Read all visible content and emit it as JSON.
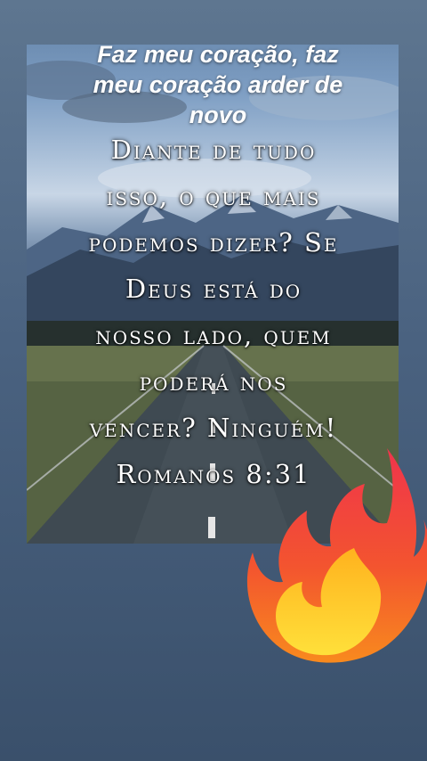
{
  "caption": {
    "lines": [
      "Faz meu coração, faz",
      "meu coração arder de",
      "novo"
    ]
  },
  "verse": {
    "lines": [
      "Diante de tudo",
      "isso, o que mais",
      "podemos dizer? Se",
      "Deus está do",
      "nosso lado, quem",
      "poderá nos",
      "vencer? Ninguém!",
      "Romanos 8:31"
    ]
  },
  "sticker": {
    "icon": "fire-icon"
  },
  "colors": {
    "background": "#4a6280",
    "sky": "#7f9fc4",
    "road": "#3f4a52",
    "fire_outer": "#f0344c",
    "fire_inner": "#ffd21e"
  }
}
